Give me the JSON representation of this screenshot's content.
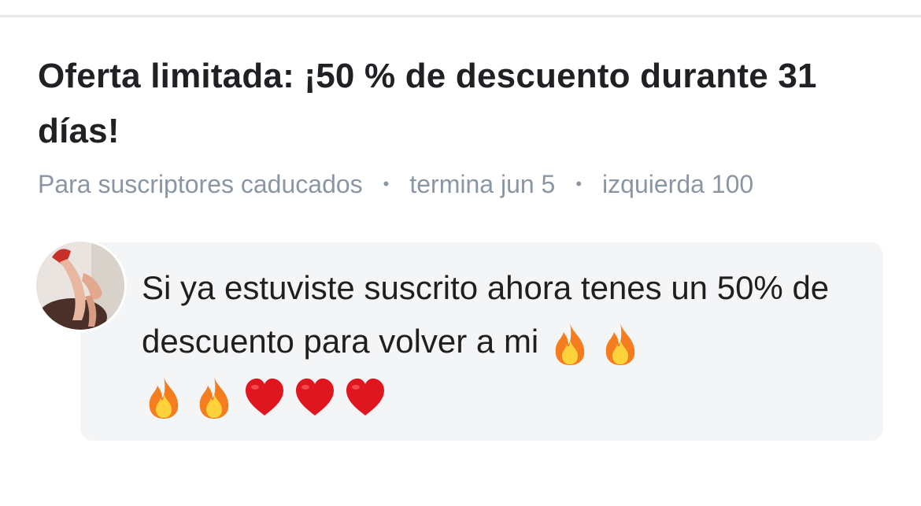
{
  "offer": {
    "title": "Oferta limitada: ¡50 % de descuento durante 31 días!",
    "audience": "Para suscriptores caducados",
    "ends": "termina jun 5",
    "remaining": "izquierda 100",
    "separator": "•"
  },
  "message": {
    "text": "Si ya estuviste suscrito ahora tenes un 50% de descuento para volver a mi",
    "trailing_emojis": [
      "fire-icon",
      "fire-icon",
      "fire-icon",
      "fire-icon",
      "heart-icon",
      "heart-icon",
      "heart-icon"
    ]
  },
  "colors": {
    "title": "#202124",
    "meta": "#8a96a3",
    "bubble_bg": "#f4f5f7",
    "divider": "#e6e8eb",
    "heart": "#e0161f",
    "fire_outer": "#f57c1f",
    "fire_inner": "#fdd23b"
  }
}
